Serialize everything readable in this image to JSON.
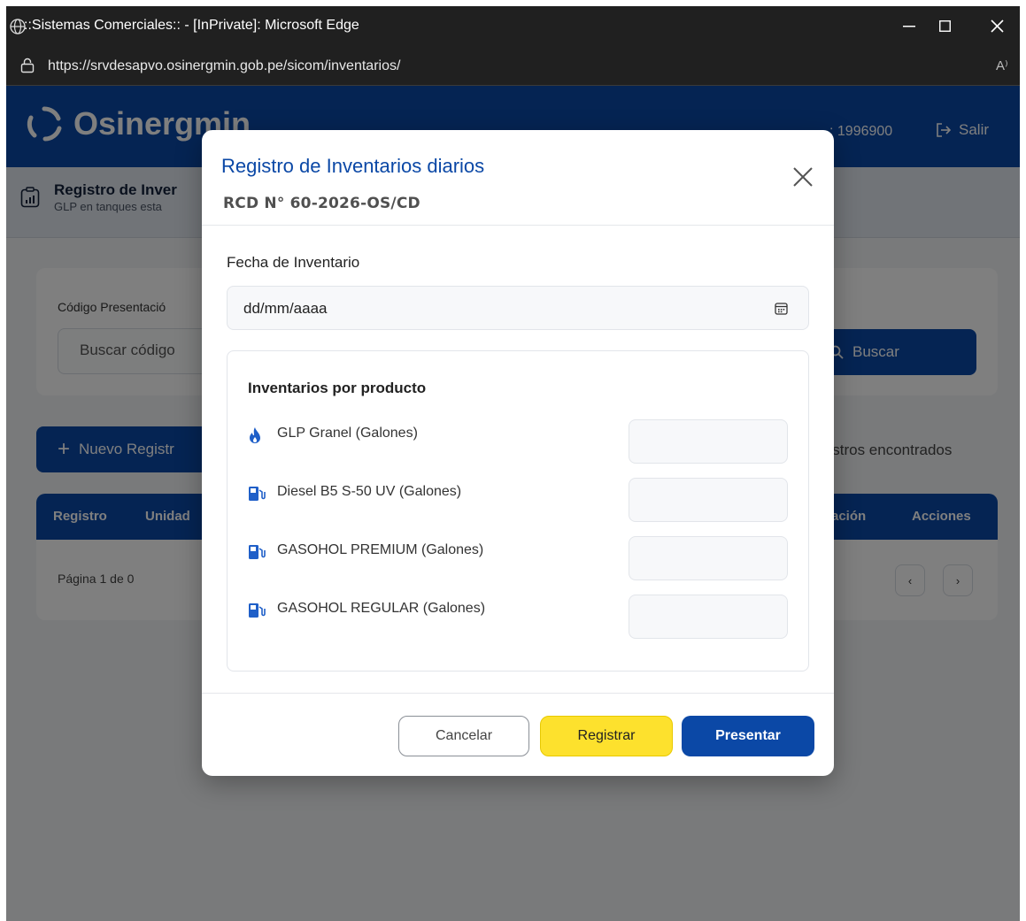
{
  "browser": {
    "window_title": "::Sistemas Comerciales:: - [InPrivate]: Microsoft Edge",
    "url": "https://srvdesapvo.osinergmin.gob.pe/sicom/inventarios/",
    "read_aloud": "A⁾"
  },
  "header": {
    "brand": "Osinergmin",
    "user_code": ": 1996900",
    "logout_label": "Salir"
  },
  "page": {
    "title": "Registro de Inver",
    "subtitle": "GLP en tanques esta"
  },
  "search": {
    "code_label": "Código Presentació",
    "code_placeholder": "Buscar código",
    "search_button": "Buscar"
  },
  "actions": {
    "new_button": "Nuevo Registr",
    "found_text": "gistros encontrados"
  },
  "table": {
    "headers": [
      "Registro",
      "Unidad",
      "tación",
      "Acciones"
    ],
    "pager_text": "Página 1 de 0",
    "prev": "‹",
    "next": "›"
  },
  "modal": {
    "title": "Registro de Inventarios diarios",
    "subtitle": "RCD N° 60-2026-OS/CD",
    "date_label": "Fecha de Inventario",
    "date_value": "dd/mm/aaaa",
    "products_title": "Inventarios por producto",
    "products": [
      {
        "label": "GLP Granel (Galones)",
        "icon": "flame-icon",
        "value": ""
      },
      {
        "label": "Diesel B5 S-50 UV (Galones)",
        "icon": "fuel-pump-icon",
        "value": ""
      },
      {
        "label": "GASOHOL PREMIUM (Galones)",
        "icon": "fuel-pump-icon",
        "value": ""
      },
      {
        "label": "GASOHOL REGULAR (Galones)",
        "icon": "fuel-pump-icon",
        "value": ""
      }
    ],
    "cancel_label": "Cancelar",
    "register_label": "Registrar",
    "submit_label": "Presentar"
  },
  "colors": {
    "primary": "#0b48a6",
    "accent_yellow": "#fde12d",
    "chrome_dark": "#202020"
  }
}
